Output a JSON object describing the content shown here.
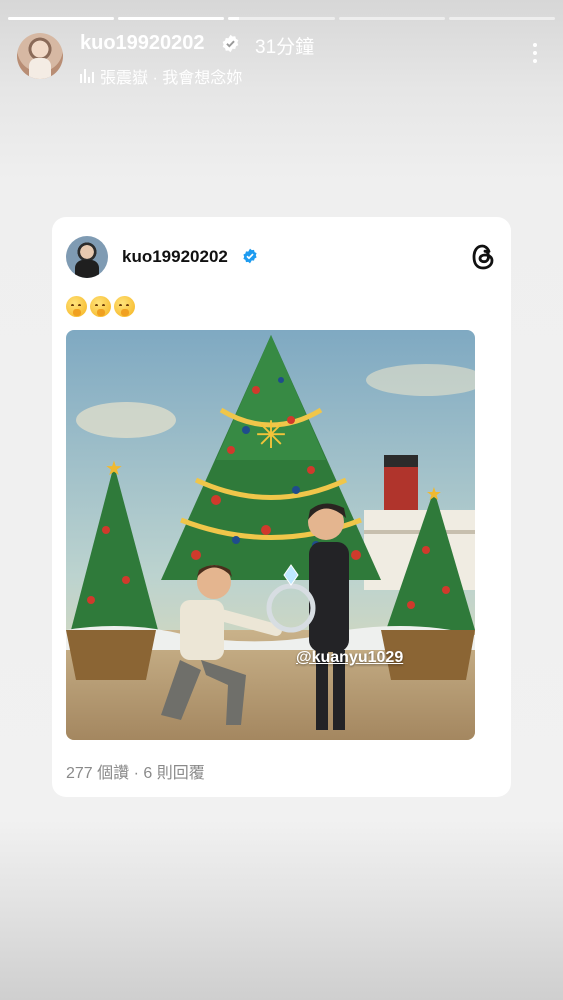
{
  "story": {
    "progress_segments": [
      1,
      1,
      0.1,
      0,
      0
    ]
  },
  "header": {
    "username": "kuo19920202",
    "time_ago": "31分鐘",
    "music_label": "張震嶽 · 我會想念妳",
    "avatar_icon": "user-avatar",
    "more_icon": "more-vertical-icon"
  },
  "post": {
    "username": "kuo19920202",
    "verified_icon": "verified-badge-icon",
    "app_icon": "threads-logo-icon",
    "emojis": [
      "shushing-face",
      "shushing-face",
      "shushing-face"
    ],
    "image_description_icon": "christmas-proposal-image",
    "mention": "@kuanyu1029",
    "stats": "277 個讚 · 6 則回覆"
  },
  "colors": {
    "verified_blue": "#1d9bf0",
    "card_bg": "#ffffff",
    "stats_gray": "#8a8a8a"
  }
}
